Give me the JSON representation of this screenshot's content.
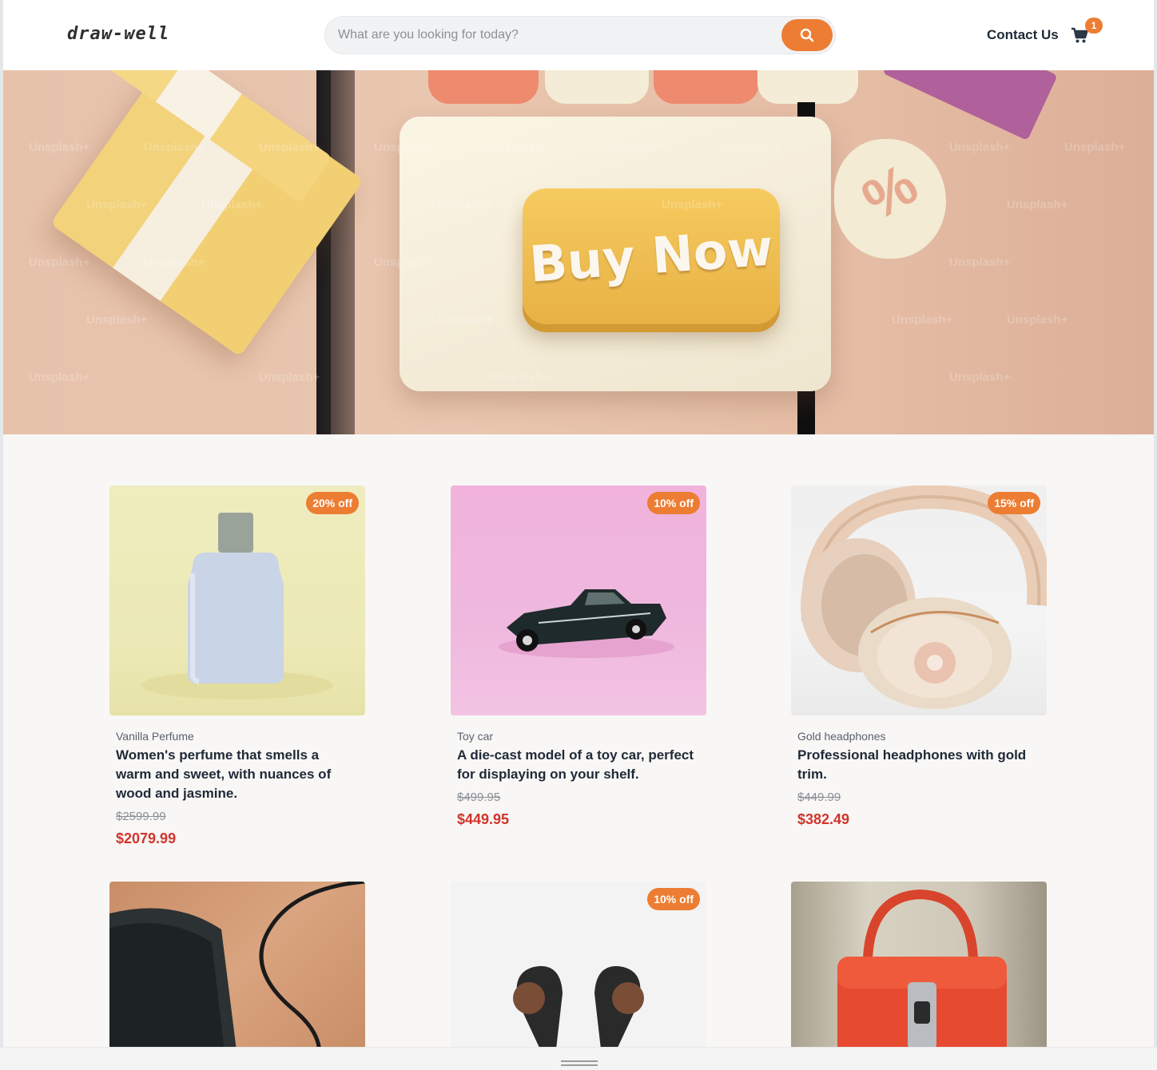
{
  "header": {
    "logo": "draw-well",
    "search_placeholder": "What are you looking for today?",
    "contact_label": "Contact Us",
    "cart_count": "1"
  },
  "hero": {
    "button_text": "Buy Now",
    "percent_symbol": "%",
    "watermark": "Unsplash+"
  },
  "colors": {
    "accent": "#ec7d33",
    "sale_price": "#d0342c"
  },
  "products": [
    {
      "discount": "20% off",
      "category": "Vanilla Perfume",
      "description": "Women's perfume that smells a warm and sweet, with nuances of wood and jasmine.",
      "old_price": "$2599.99",
      "new_price": "$2079.99"
    },
    {
      "discount": "10% off",
      "category": "Toy car",
      "description": "A die-cast model of a toy car, perfect for displaying on your shelf.",
      "old_price": "$499.95",
      "new_price": "$449.95"
    },
    {
      "discount": "15% off",
      "category": "Gold headphones",
      "description": "Professional headphones with gold trim.",
      "old_price": "$449.99",
      "new_price": "$382.49"
    },
    {
      "discount": "",
      "category": "",
      "description": "",
      "old_price": "",
      "new_price": ""
    },
    {
      "discount": "10% off",
      "category": "",
      "description": "",
      "old_price": "",
      "new_price": ""
    },
    {
      "discount": "",
      "category": "",
      "description": "",
      "old_price": "",
      "new_price": ""
    }
  ]
}
